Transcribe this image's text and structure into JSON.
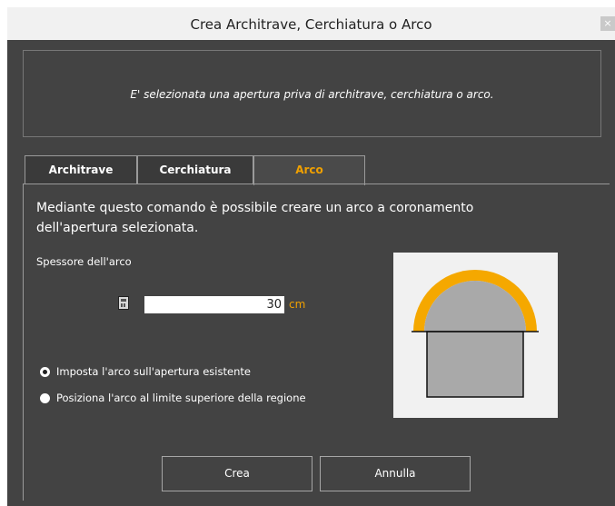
{
  "window": {
    "title": "Crea Architrave, Cerchiatura o Arco",
    "close_glyph": "×"
  },
  "header": {
    "message": "E' selezionata una apertura priva di architrave, cerchiatura o arco."
  },
  "tabs": [
    {
      "label": "Architrave",
      "active": false
    },
    {
      "label": "Cerchiatura",
      "active": false
    },
    {
      "label": "Arco",
      "active": true
    }
  ],
  "arco": {
    "description": "Mediante questo comando è possibile creare un arco a coronamento dell'apertura selezionata.",
    "thickness_label": "Spessore dell'arco",
    "thickness_value": "30",
    "thickness_unit": "cm",
    "calculator_icon": "calculator-icon",
    "options": [
      {
        "label": "Imposta l'arco sull'apertura esistente",
        "checked": true
      },
      {
        "label": "Posiziona l'arco al limite superiore della regione",
        "checked": false
      }
    ]
  },
  "buttons": {
    "create": "Crea",
    "cancel": "Annulla"
  },
  "colors": {
    "accent": "#f0a000",
    "background": "#434343",
    "preview_fill": "#a9a9a9",
    "arch": "#f5a800"
  }
}
